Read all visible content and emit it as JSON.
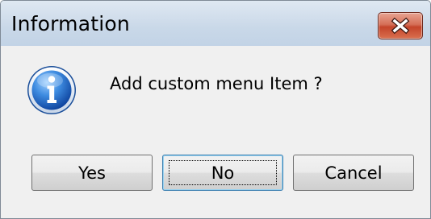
{
  "window": {
    "title": "Information",
    "close_icon": "close-icon"
  },
  "dialog": {
    "icon": "info-icon",
    "message": "Add custom menu Item ?"
  },
  "buttons": {
    "yes": "Yes",
    "no": "No",
    "cancel": "Cancel"
  },
  "colors": {
    "close_button": "#c4442a",
    "titlebar": "#c9d8e8",
    "info_icon": "#2a6fc9"
  }
}
